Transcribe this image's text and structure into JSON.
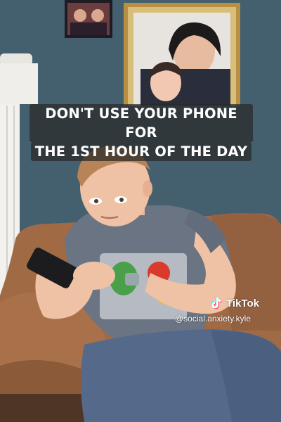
{
  "caption": {
    "line1": "DON'T USE YOUR PHONE FOR",
    "line2": "THE 1ST HOUR OF THE DAY"
  },
  "watermark": {
    "brand": "TikTok",
    "handle": "@social.anxiety.kyle",
    "icon": "tiktok-logo-icon"
  },
  "colors": {
    "wall": "#3f5a6c",
    "couch": "#a8714a",
    "shirt": "#6b7584",
    "frame": "#b88f43"
  }
}
